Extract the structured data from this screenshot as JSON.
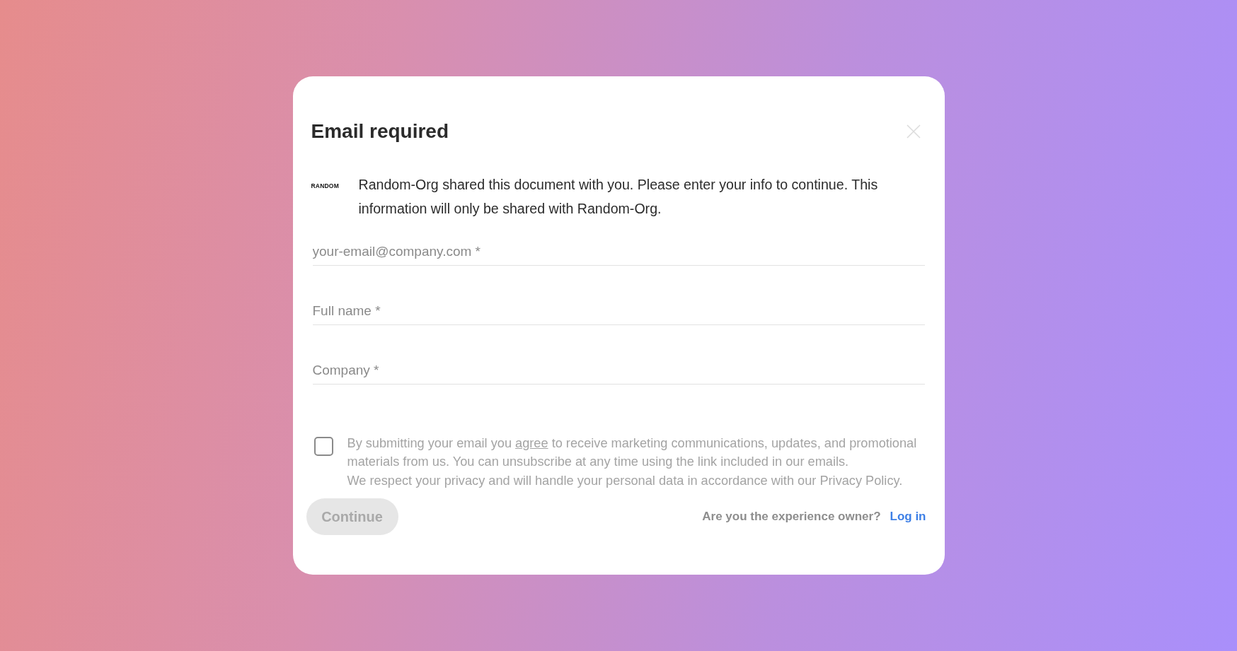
{
  "dialog": {
    "title": "Email required",
    "logo_text": "RANDOM",
    "message": "Random-Org shared this document with you. Please enter your info to continue. This information will only be shared with Random-Org."
  },
  "fields": [
    {
      "placeholder": "your-email@company.com *"
    },
    {
      "placeholder": "Full name *"
    },
    {
      "placeholder": "Company *"
    }
  ],
  "consent": {
    "checked": false,
    "before": "By submitting your email you ",
    "link": "agree",
    "after": " to receive marketing communications, updates, and promotional materials from us. You can unsubscribe at any time using the link included in our emails.",
    "privacy": "We respect your privacy and will handle your personal data in accordance with our Privacy Policy."
  },
  "footer": {
    "button": {
      "label": "Continue",
      "disabled": true
    },
    "question": "Are you the experience owner?",
    "login": "Log in"
  }
}
